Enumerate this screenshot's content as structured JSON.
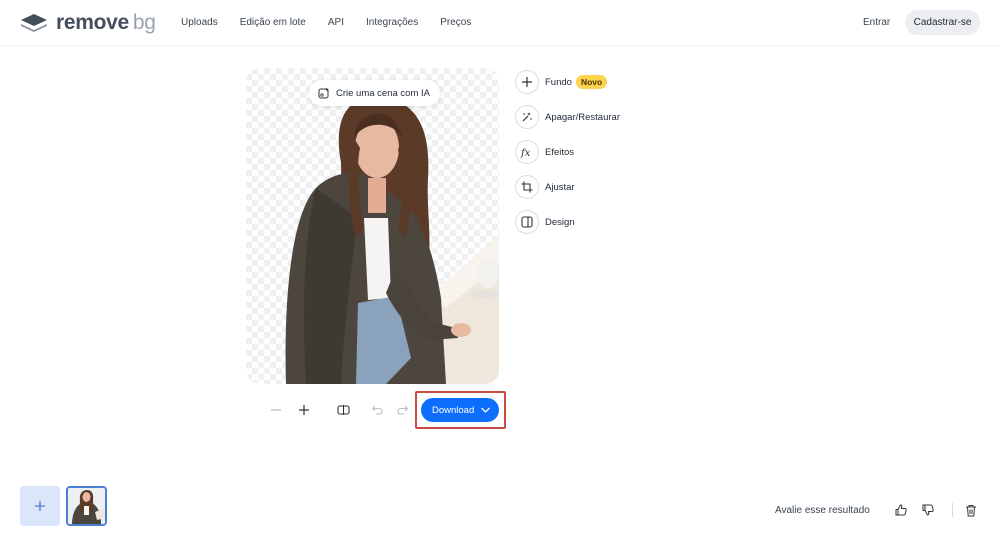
{
  "header": {
    "logo": {
      "word1": "remove",
      "word2": "bg"
    },
    "nav": [
      "Uploads",
      "Edição em lote",
      "API",
      "Integrações",
      "Preços"
    ],
    "login_label": "Entrar",
    "signup_label": "Cadastrar-se"
  },
  "editor": {
    "ai_scene_label": "Crie uma cena com IA",
    "tools": [
      {
        "label": "Fundo",
        "icon": "plus-icon",
        "badge": "Novo"
      },
      {
        "label": "Apagar/Restaurar",
        "icon": "magic-wand-icon"
      },
      {
        "label": "Efeitos",
        "icon": "fx-icon"
      },
      {
        "label": "Ajustar",
        "icon": "crop-icon"
      },
      {
        "label": "Design",
        "icon": "design-layout-icon"
      }
    ],
    "download_label": "Download"
  },
  "footer": {
    "rate_label": "Avalie esse resultado"
  },
  "colors": {
    "accent": "#0d6efd",
    "badge": "#fcd34d",
    "highlight": "#c84b46"
  }
}
